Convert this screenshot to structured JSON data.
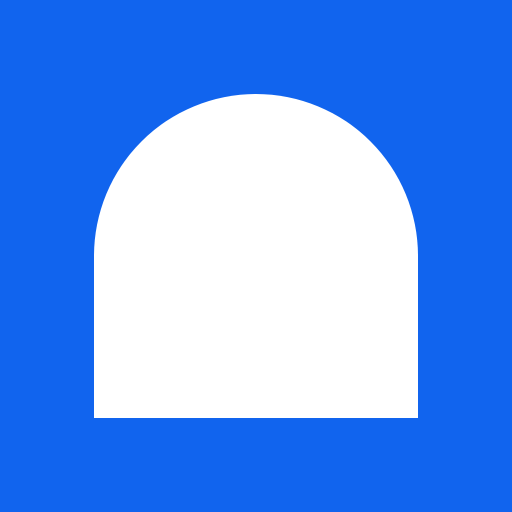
{
  "icon": {
    "name": "arch-icon",
    "background_color": "#1164EE",
    "foreground_color": "#FFFFFF"
  }
}
